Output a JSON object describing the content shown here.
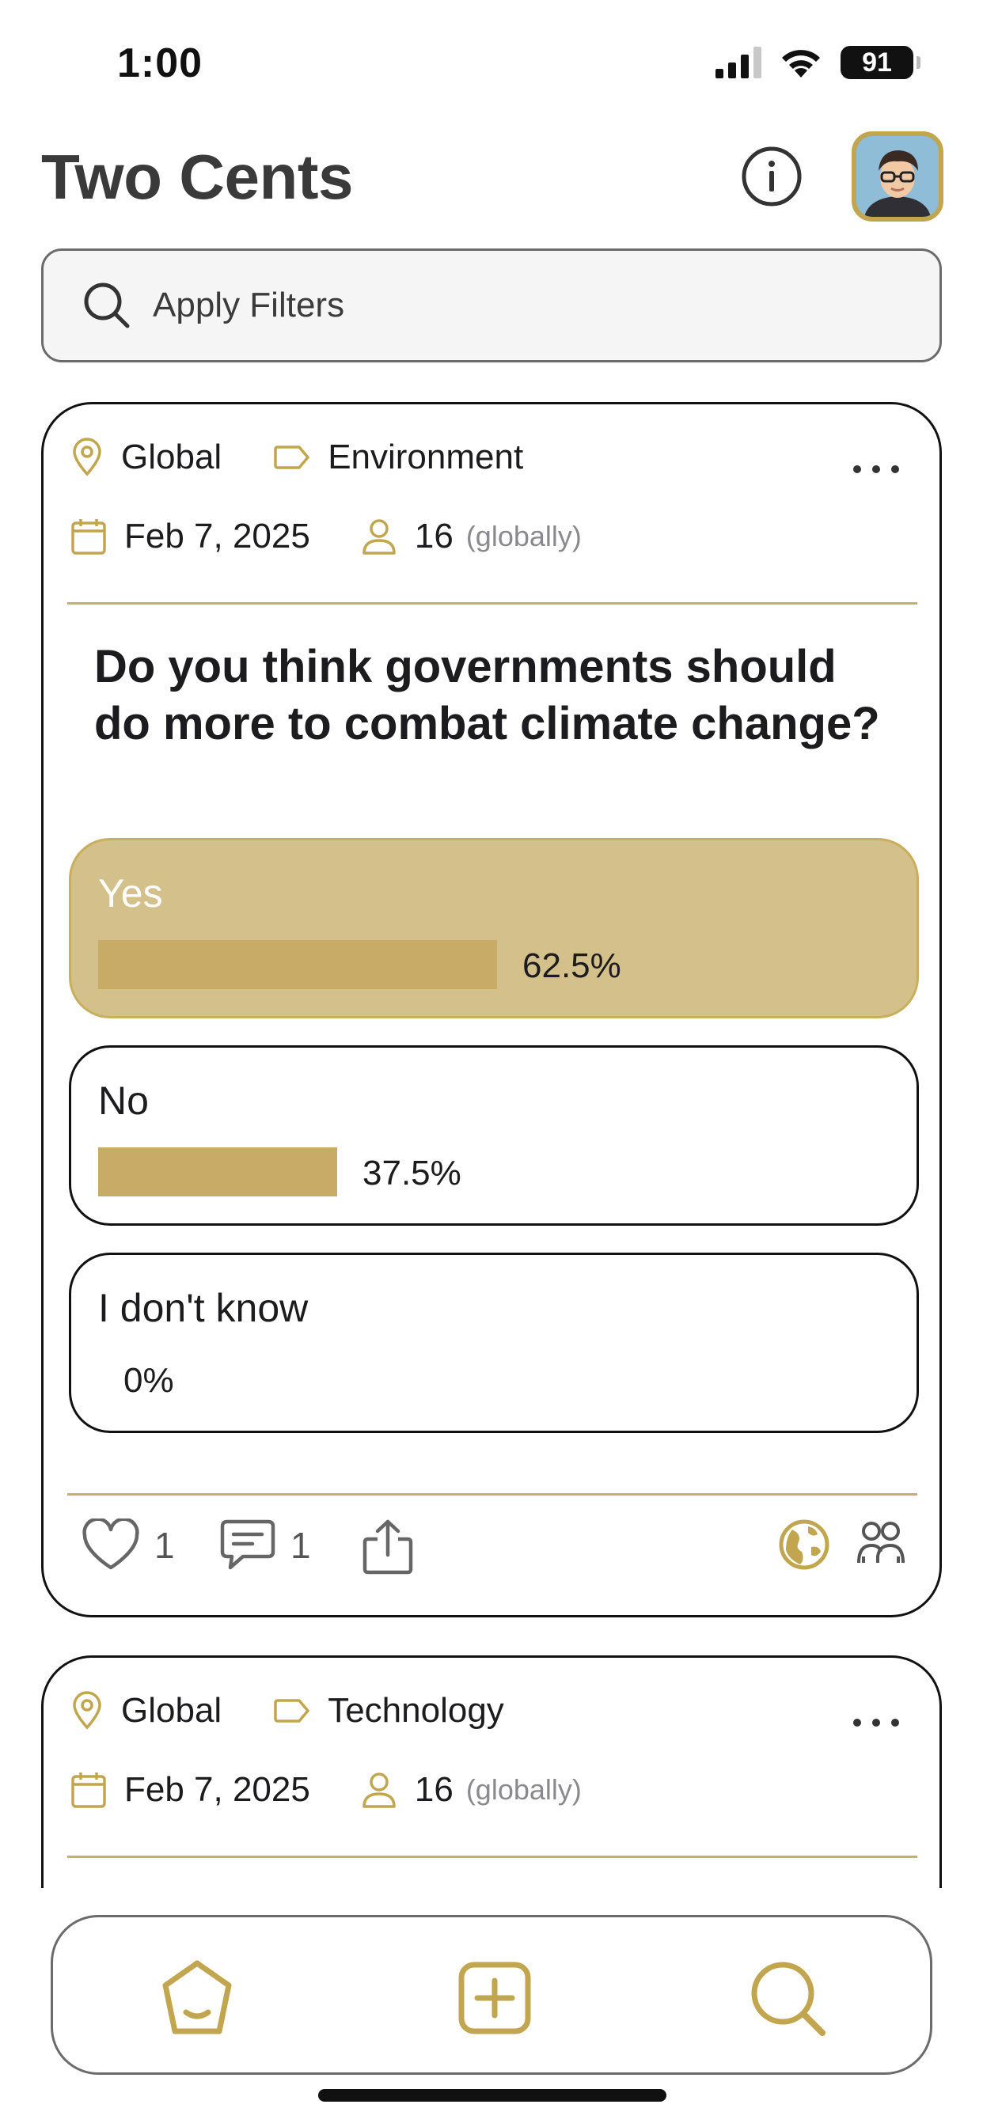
{
  "status_bar": {
    "time": "1:00",
    "battery": "91"
  },
  "header": {
    "title": "Two Cents"
  },
  "search": {
    "label": "Apply Filters"
  },
  "colors": {
    "accent": "#c2a64f",
    "selected_option_bg": "#d4c08a",
    "bar_fill": "#c7ab67",
    "divider": "#c9b066"
  },
  "polls": [
    {
      "location": "Global",
      "category": "Environment",
      "date": "Feb 7, 2025",
      "participants": "16",
      "scope": "(globally)",
      "question": "Do you think governments should do more to combat climate change?",
      "options": [
        {
          "label": "Yes",
          "percent_text": "62.5%",
          "percent": 62.5,
          "selected": true
        },
        {
          "label": "No",
          "percent_text": "37.5%",
          "percent": 37.5,
          "selected": false
        },
        {
          "label": "I don't know",
          "percent_text": "0%",
          "percent": 0,
          "selected": false
        }
      ],
      "likes": "1",
      "comments": "1"
    },
    {
      "location": "Global",
      "category": "Technology",
      "date": "Feb 7, 2025",
      "participants": "16",
      "scope": "(globally)"
    }
  ],
  "icons": {
    "status": [
      "cellular-signal-icon",
      "wifi-icon",
      "battery-icon"
    ],
    "header": [
      "info-icon",
      "avatar"
    ],
    "card_meta": [
      "location-pin-icon",
      "tag-icon",
      "calendar-icon",
      "person-icon",
      "more-icon"
    ],
    "card_actions": [
      "heart-icon",
      "comment-icon",
      "share-icon",
      "globe-icon",
      "group-icon"
    ],
    "tabs": [
      "home-icon",
      "add-icon",
      "search-icon"
    ]
  }
}
